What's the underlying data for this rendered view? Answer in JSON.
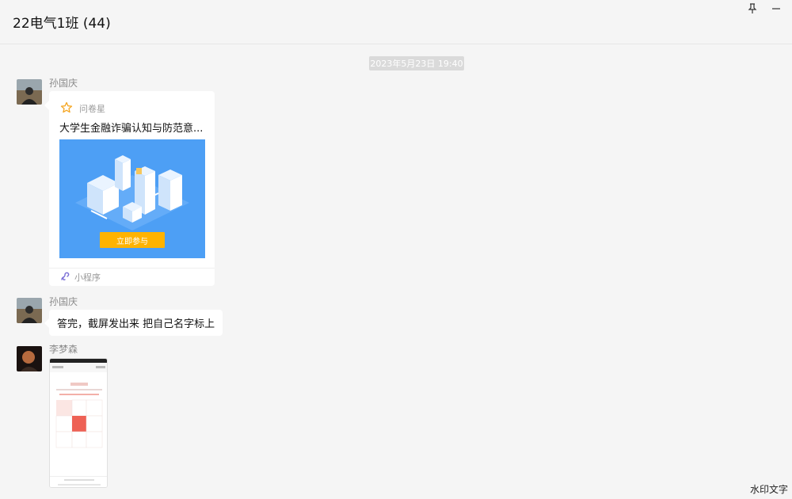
{
  "window": {
    "title": "22电气1班 (44)",
    "pin_glyph": "📌",
    "minimize_glyph": "−"
  },
  "timestamp": "2023年5月23日 19:40",
  "messages": [
    {
      "sender": "孙国庆",
      "type": "mini-program-card",
      "card": {
        "source": "问卷星",
        "title": "大学生金融诈骗认知与防范意...",
        "button_label": "立即参与",
        "footer_label": "小程序"
      }
    },
    {
      "sender": "孙国庆",
      "type": "text",
      "text": "答完，截屏发出来 把自己名字标上"
    },
    {
      "sender": "李梦森",
      "type": "image"
    }
  ],
  "watermark": "水印文字",
  "colors": {
    "banner": "#4d9ff5",
    "banner_button": "#ffb300",
    "star": "#f5a623"
  }
}
